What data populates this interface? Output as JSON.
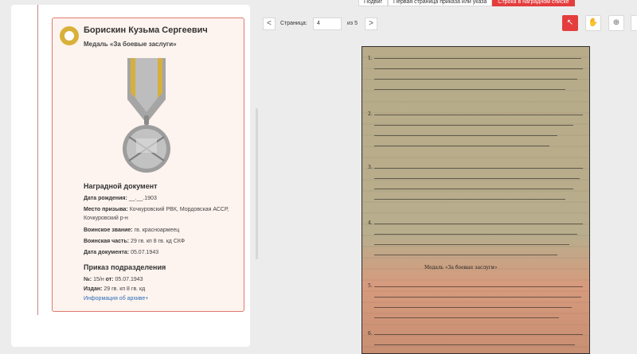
{
  "top_buttons": {
    "first": "Подвиг",
    "second": "Первая страница приказа или указа",
    "third": "Строка в наградном списке"
  },
  "left": {
    "person_name": "Борискин Кузьма Сергеевич",
    "medal": "Медаль «За боевые заслуги»",
    "award_doc_title": "Наградной документ",
    "fields": [
      {
        "label": "Дата рождения:",
        "value": "__.__.1903"
      },
      {
        "label": "Место призыва:",
        "value": "Кочкуровский РВК, Мордовская АССР, Кочкуровский р-н"
      },
      {
        "label": "Воинское звание:",
        "value": "гв. красноармеец"
      },
      {
        "label": "Воинская часть:",
        "value": "29 гв. кп 8 гв. кд СКФ"
      },
      {
        "label": "Дата документа:",
        "value": "05.07.1943"
      }
    ],
    "order_title": "Приказ подразделения",
    "order_fields": [
      {
        "label": "№:",
        "value": "15/н"
      },
      {
        "label": "от:",
        "value": "05.07.1943"
      },
      {
        "label": "Издан:",
        "value": "29 гв. кп 8 гв. кд"
      }
    ],
    "archive_link": "Информация об архиве+"
  },
  "pager": {
    "prev": "<",
    "label": "Страница:",
    "current": "4",
    "total": "из 5",
    "next": ">"
  },
  "tools": {
    "cursor": "↖",
    "hand": "✋",
    "zoom": "⊕"
  },
  "document": {
    "num1": "1.",
    "num2": "2.",
    "num3": "3.",
    "num4": "4.",
    "section": "Медаль «За боевые заслуги»",
    "num5": "5.",
    "num6": "6."
  }
}
